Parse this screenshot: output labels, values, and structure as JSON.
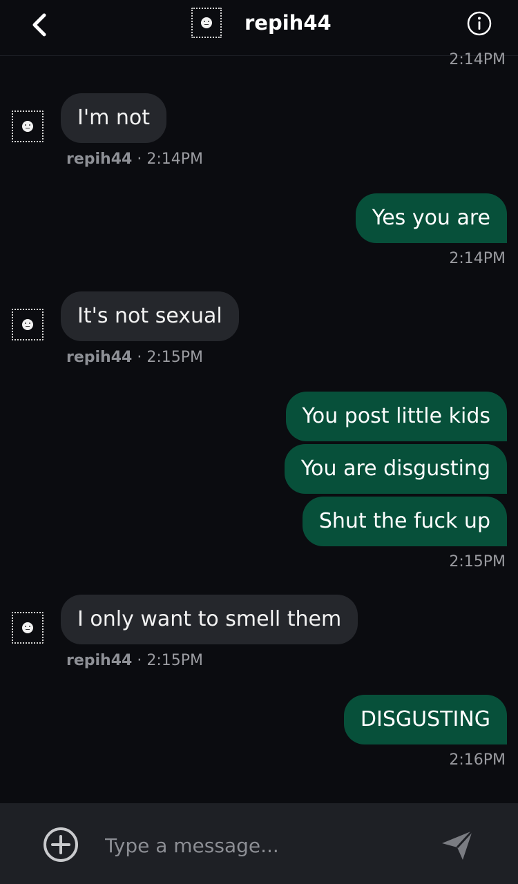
{
  "header": {
    "username": "repih44",
    "back_icon": "chevron-left-icon",
    "info_icon": "info-icon"
  },
  "messages": [
    {
      "direction": "out",
      "time": "2:14PM"
    },
    {
      "direction": "in",
      "text": "I'm not",
      "sender": "repih44",
      "time": "2:14PM"
    },
    {
      "direction": "out",
      "text": "Yes you are",
      "time": "2:14PM"
    },
    {
      "direction": "in",
      "text": "It's not sexual",
      "sender": "repih44",
      "time": "2:15PM"
    },
    {
      "direction": "out",
      "text": "You post little kids"
    },
    {
      "direction": "out",
      "text": "You are disgusting"
    },
    {
      "direction": "out",
      "text": "Shut the fuck up",
      "time": "2:15PM"
    },
    {
      "direction": "in",
      "text": "I only want to smell them",
      "sender": "repih44",
      "time": "2:15PM"
    },
    {
      "direction": "out",
      "text": "DISGUSTING",
      "time": "2:16PM"
    }
  ],
  "meta_separator": "·",
  "composer": {
    "placeholder": "Type a message...",
    "add_icon": "plus-circle-icon",
    "send_icon": "send-icon"
  },
  "colors": {
    "background": "#0b0c10",
    "incoming_bubble": "#25272c",
    "outgoing_bubble": "#07503a",
    "composer": "#1e2025"
  }
}
